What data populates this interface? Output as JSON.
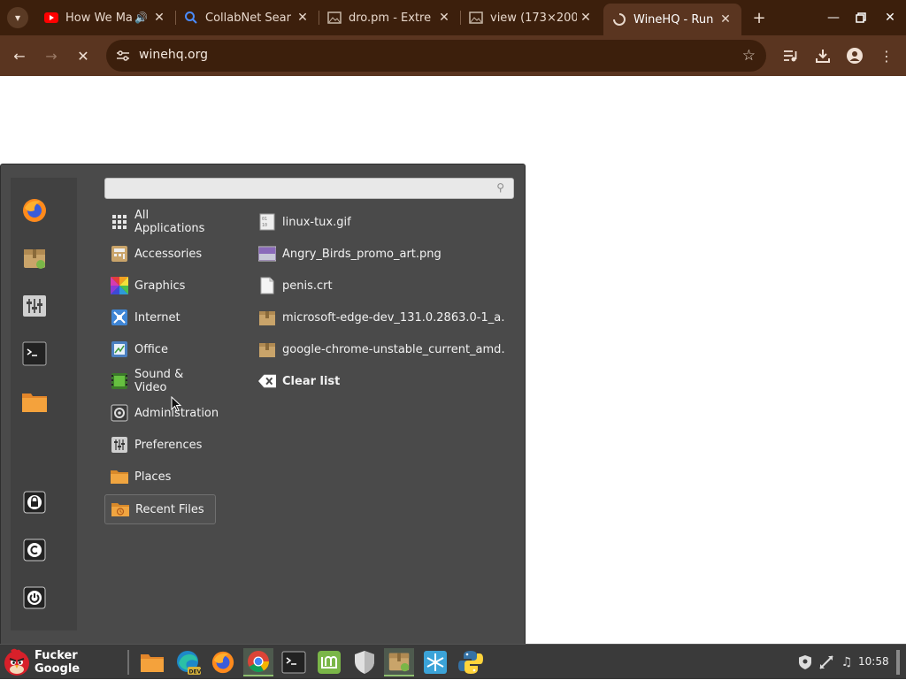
{
  "browser": {
    "tabs": [
      {
        "title": "How We Ma",
        "favicon": "youtube-icon",
        "audio": true
      },
      {
        "title": "CollabNet Sear",
        "favicon": "search-icon"
      },
      {
        "title": "dro.pm - Extre",
        "favicon": "image-icon"
      },
      {
        "title": "view (173×200)",
        "favicon": "image-icon"
      },
      {
        "title": "WineHQ - Run",
        "favicon": "loading-icon",
        "active": true
      }
    ],
    "url": "winehq.org"
  },
  "menu": {
    "search_placeholder": "",
    "favorites": [
      "firefox-icon",
      "software-manager-icon",
      "settings-icon",
      "terminal-icon",
      "files-icon"
    ],
    "session": [
      "lock-screen-icon",
      "logout-icon",
      "shutdown-icon"
    ],
    "categories": [
      {
        "label": "All Applications",
        "icon": "grid-icon"
      },
      {
        "label": "Accessories",
        "icon": "accessories-icon"
      },
      {
        "label": "Graphics",
        "icon": "graphics-icon"
      },
      {
        "label": "Internet",
        "icon": "internet-icon"
      },
      {
        "label": "Office",
        "icon": "office-icon"
      },
      {
        "label": "Sound & Video",
        "icon": "sound-video-icon"
      },
      {
        "label": "Administration",
        "icon": "administration-icon"
      },
      {
        "label": "Preferences",
        "icon": "preferences-icon"
      },
      {
        "label": "Places",
        "icon": "folder-icon"
      },
      {
        "label": "Recent Files",
        "icon": "recent-files-icon",
        "selected": true
      }
    ],
    "recent_files": [
      {
        "name": "linux-tux.gif",
        "icon": "binary-file-icon"
      },
      {
        "name": "Angry_Birds_promo_art.png",
        "icon": "image-file-icon"
      },
      {
        "name": "penis.crt",
        "icon": "text-file-icon"
      },
      {
        "name": "microsoft-edge-dev_131.0.2863.0-1_a…",
        "icon": "package-icon"
      },
      {
        "name": "google-chrome-unstable_current_amd…",
        "icon": "package-icon"
      },
      {
        "name": "Clear list",
        "icon": "clear-icon"
      }
    ]
  },
  "taskbar": {
    "menu_label": "Fucker Google",
    "clock": "10:58",
    "apps": [
      "files-icon",
      "edge-dev-icon",
      "firefox-icon",
      "chrome-icon",
      "terminal-icon",
      "mintinstall-icon",
      "shield-icon",
      "package-manager-icon",
      "snowflake-icon",
      "python-icon"
    ]
  },
  "colors": {
    "titlebar": "#3c1f0c",
    "toolbar": "#5a3520",
    "menu_bg": "#4a4a4a",
    "taskbar": "#3a3a3a"
  }
}
